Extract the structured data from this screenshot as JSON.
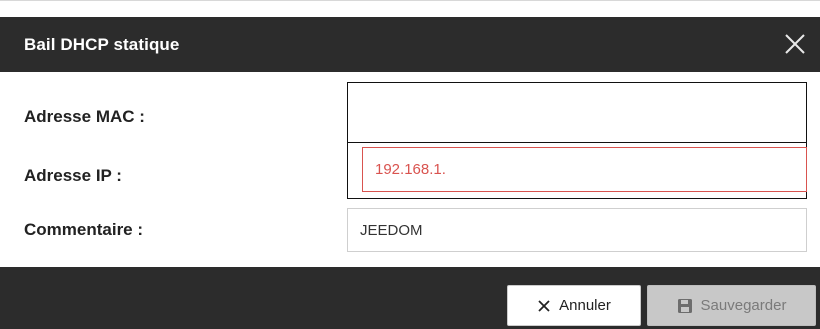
{
  "dialog": {
    "title": "Bail DHCP statique",
    "close_icon": "close-icon"
  },
  "form": {
    "mac": {
      "label": "Adresse MAC :",
      "value": ""
    },
    "ip": {
      "label": "Adresse IP :",
      "value": "192.168.1."
    },
    "comment": {
      "label": "Commentaire :",
      "value": "JEEDOM"
    }
  },
  "footer": {
    "cancel_label": "Annuler",
    "cancel_icon": "x-icon",
    "save_label": "Sauvegarder",
    "save_icon": "floppy-disk-icon"
  },
  "colors": {
    "header_bg": "#2c2c2c",
    "error_red": "#d9534f",
    "disabled_bg": "#c8c8c8"
  }
}
